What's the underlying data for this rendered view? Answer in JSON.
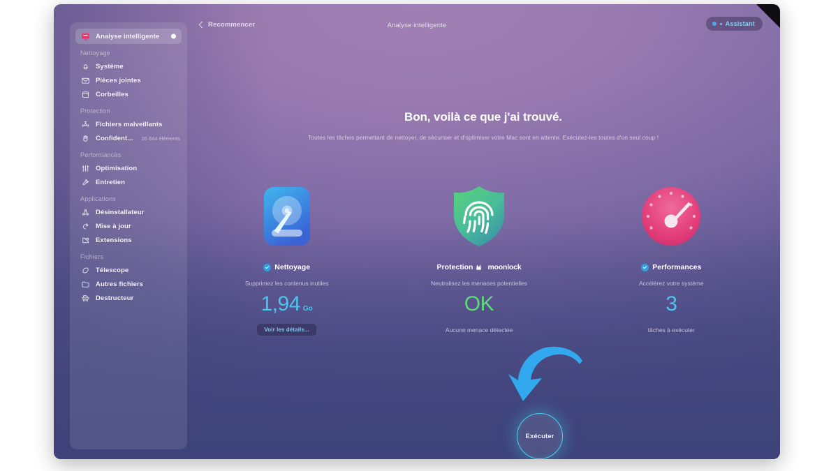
{
  "colors": {
    "accent_blue": "#2f9fe0",
    "accent_cyan": "#49d2ef",
    "ok_green": "#5fd97a",
    "brand_pink": "#e24a7a",
    "text_primary": "#ffffff"
  },
  "titlebar": {
    "back_label": "Recommencer",
    "window_title": "Analyse intelligente",
    "assistant_label": "Assistant"
  },
  "sidebar": {
    "active": {
      "label": "Analyse intelligente",
      "icon": "monitor-scan-icon"
    },
    "groups": [
      {
        "label": "Nettoyage",
        "items": [
          {
            "label": "Système",
            "icon": "broom-icon",
            "count": ""
          },
          {
            "label": "Pièces jointes",
            "icon": "mail-icon",
            "count": ""
          },
          {
            "label": "Corbeilles",
            "icon": "trash-icon",
            "count": ""
          }
        ]
      },
      {
        "label": "Protection",
        "items": [
          {
            "label": "Fichiers malveillants",
            "icon": "biohazard-icon",
            "count": ""
          },
          {
            "label": "Confident...",
            "icon": "hand-icon",
            "count": "26 844 éléments"
          }
        ]
      },
      {
        "label": "Performances",
        "items": [
          {
            "label": "Optimisation",
            "icon": "sliders-icon",
            "count": ""
          },
          {
            "label": "Entretien",
            "icon": "wrench-icon",
            "count": ""
          }
        ]
      },
      {
        "label": "Applications",
        "items": [
          {
            "label": "Désinstallateur",
            "icon": "molecule-icon",
            "count": ""
          },
          {
            "label": "Mise à jour",
            "icon": "refresh-icon",
            "count": ""
          },
          {
            "label": "Extensions",
            "icon": "puzzle-icon",
            "count": ""
          }
        ]
      },
      {
        "label": "Fichiers",
        "items": [
          {
            "label": "Télescope",
            "icon": "telescope-icon",
            "count": ""
          },
          {
            "label": "Autres fichiers",
            "icon": "folder-icon",
            "count": ""
          },
          {
            "label": "Destructeur",
            "icon": "shredder-icon",
            "count": ""
          }
        ]
      }
    ]
  },
  "hero": {
    "heading": "Bon, voilà ce que j'ai trouvé.",
    "subheading": "Toutes les tâches permettant de nettoyer, de sécuriser et d'optimiser votre Mac sont en attente. Exécutez-les toutes d'un seul coup !"
  },
  "cards": [
    {
      "icon": "hard-drive-icon",
      "title": "Nettoyage",
      "has_check": true,
      "subtitle": "Supprimez les contenus inutiles",
      "value": "1,94",
      "unit": "Go",
      "value_color": "#4cc4ef",
      "footer_type": "button",
      "footer_label": "Voir les détails..."
    },
    {
      "icon": "shield-fingerprint-icon",
      "title": "Protection",
      "brand": "moonlock",
      "has_check": false,
      "subtitle": "Neutralisez les menaces potentielles",
      "value": "OK",
      "unit": "",
      "value_color": "#5fd97a",
      "footer_type": "text",
      "footer_label": "Aucune menace détectée"
    },
    {
      "icon": "speedometer-icon",
      "title": "Performances",
      "has_check": true,
      "subtitle": "Accélérez votre système",
      "value": "3",
      "unit": "",
      "value_color": "#4cc4ef",
      "footer_type": "text",
      "footer_label": "tâches à exécuter"
    }
  ],
  "run_button": {
    "label": "Exécuter",
    "arrow_icon": "curved-down-arrow-icon"
  }
}
